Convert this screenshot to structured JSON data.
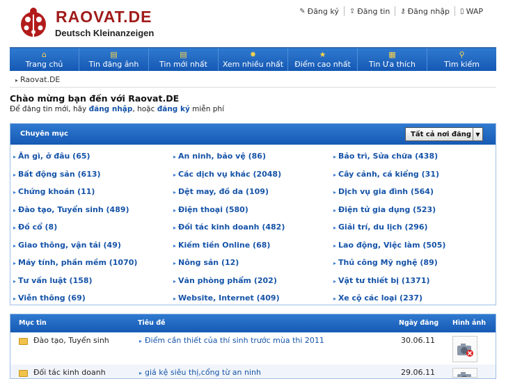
{
  "header": {
    "logo_text": "RAOVAT.DE",
    "logo_sub": "Deutsch Kleinanzeigen",
    "links": [
      {
        "label": "Đăng ký",
        "icon": "pencil-icon"
      },
      {
        "label": "Đăng tin",
        "icon": "post-icon"
      },
      {
        "label": "Đăng nhập",
        "icon": "key-icon"
      },
      {
        "label": "WAP",
        "icon": "phone-icon"
      }
    ]
  },
  "nav": [
    {
      "label": "Trang chủ",
      "icon": "home-icon"
    },
    {
      "label": "Tin đăng ảnh",
      "icon": "photo-icon"
    },
    {
      "label": "Tin mới nhất",
      "icon": "new-icon"
    },
    {
      "label": "Xem nhiều nhất",
      "icon": "hot-icon"
    },
    {
      "label": "Điểm cao nhất",
      "icon": "star-icon"
    },
    {
      "label": "Tin Ưa thích",
      "icon": "favorite-icon"
    },
    {
      "label": "Tìm kiếm",
      "icon": "search-icon"
    }
  ],
  "breadcrumb": "Raovat.DE",
  "welcome": {
    "title": "Chào mừng bạn đến với Raovat.DE",
    "prefix": "Để đăng tin mới, hãy ",
    "login": "đăng nhập",
    "middle": ", hoặc ",
    "register": "đăng ký",
    "suffix": " miễn phí"
  },
  "categories": {
    "heading": "Chuyên mục",
    "select_value": "Tất cả nơi đăng",
    "rows": [
      [
        "Ăn gì, ở đâu (65)",
        "An ninh, bảo vệ (86)",
        "Bảo trì, Sửa chữa (438)"
      ],
      [
        "Bất động sản (613)",
        "Các dịch vụ khác (2048)",
        "Cây cảnh, cá kiểng (31)"
      ],
      [
        "Chứng khoán (11)",
        "Dệt may, đồ da (109)",
        "Dịch vụ gia đình (564)"
      ],
      [
        "Đào tạo, Tuyển sinh (489)",
        "Điện thoại (580)",
        "Điện tử gia dụng (523)"
      ],
      [
        "Đồ cổ (8)",
        "Đối tác kinh doanh (482)",
        "Giải trí, du lịch (296)"
      ],
      [
        "Giao thông, vận tải (49)",
        "Kiếm tiền Online (68)",
        "Lao động, Việc làm (505)"
      ],
      [
        "Máy tính, phần mềm (1070)",
        "Nông sản (12)",
        "Thủ công Mỹ nghệ (89)"
      ],
      [
        "Tư vấn luật (158)",
        "Văn phòng phẩm (202)",
        "Vật tư thiết bị (1371)"
      ],
      [
        "Viễn thông (69)",
        "Website, Internet (409)",
        "Xe cộ các loại (237)"
      ]
    ]
  },
  "listing": {
    "headers": {
      "category": "Mục tin",
      "title": "Tiêu đề",
      "date": "Ngày đăng",
      "image": "Hình ảnh"
    },
    "rows": [
      {
        "category": "Đào tạo, Tuyển sinh",
        "title": "Điểm cần thiết của thí sinh trước mùa thi 2011",
        "date": "30.06.11"
      },
      {
        "category": "Đối tác kinh doanh",
        "title": "giá kệ siêu thị,cổng từ an ninh",
        "date": "29.06.11"
      }
    ]
  }
}
